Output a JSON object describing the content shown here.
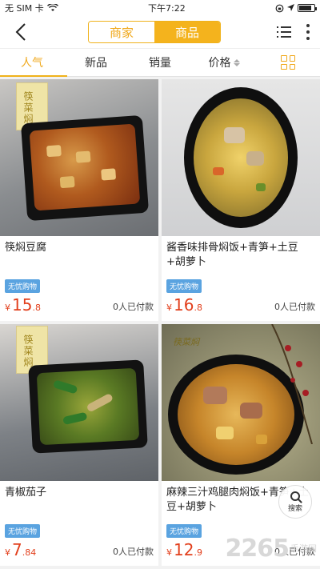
{
  "status_bar": {
    "carrier": "无 SIM 卡",
    "time": "下午7:22",
    "battery_level": 0.85
  },
  "nav": {
    "seg_left": "商家",
    "seg_right": "商品"
  },
  "sort_tabs": [
    {
      "label": "人气"
    },
    {
      "label": "新品"
    },
    {
      "label": "销量"
    },
    {
      "label": "价格"
    }
  ],
  "products": [
    {
      "name": "筷焖豆腐",
      "tag": "无忧购物",
      "currency": "¥",
      "price_int": "15",
      "price_dec": ".8",
      "paid": "0人已付款",
      "pack_label": "筷菜焖"
    },
    {
      "name": "酱香味排骨焖饭+青笋+土豆+胡萝卜",
      "tag": "无忧购物",
      "currency": "¥",
      "price_int": "16",
      "price_dec": ".8",
      "paid": "0人已付款"
    },
    {
      "name": "青椒茄子",
      "tag": "无忧购物",
      "currency": "¥",
      "price_int": "7",
      "price_dec": ".84",
      "paid": "0人已付款",
      "pack_label": "筷菜焖"
    },
    {
      "name": "麻辣三汁鸡腿肉焖饭+青笋+土豆+胡萝卜",
      "tag": "无忧购物",
      "currency": "¥",
      "price_int": "12",
      "price_dec": ".9",
      "paid": "0人已付款",
      "pack_label": "筷菜焖"
    }
  ],
  "float_search": {
    "label": "搜索"
  },
  "watermark": {
    "big": "2265",
    "small_top": "手游网",
    "small_bottom": ""
  },
  "colors": {
    "accent": "#f0b21b",
    "price": "#e23f1c",
    "tag": "#5aa3e0"
  }
}
